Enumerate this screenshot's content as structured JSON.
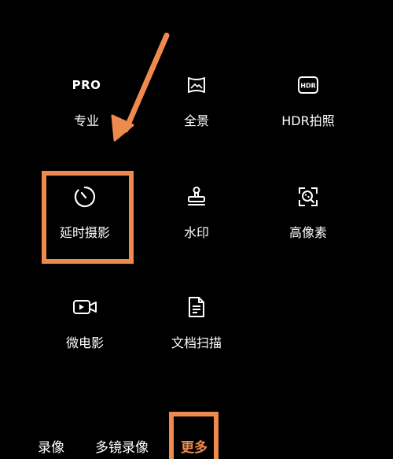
{
  "modes": [
    {
      "id": "pro",
      "icon": "pro-text-icon",
      "icon_text": "PRO",
      "label": "专业"
    },
    {
      "id": "panorama",
      "icon": "panorama-icon",
      "label": "全景"
    },
    {
      "id": "hdr",
      "icon": "hdr-icon",
      "icon_text": "HDR",
      "label": "HDR拍照"
    },
    {
      "id": "timelapse",
      "icon": "timelapse-icon",
      "label": "延时摄影"
    },
    {
      "id": "watermark",
      "icon": "stamp-icon",
      "label": "水印"
    },
    {
      "id": "high-res",
      "icon": "high-res-icon",
      "label": "高像素"
    },
    {
      "id": "micro-movie",
      "icon": "video-camera-icon",
      "label": "微电影"
    },
    {
      "id": "document-scan",
      "icon": "document-icon",
      "label": "文档扫描"
    }
  ],
  "bottom_tabs": [
    {
      "label": "录像"
    },
    {
      "label": "多镜录像"
    },
    {
      "label": "更多",
      "active": true
    }
  ],
  "colors": {
    "accent": "#ef8a4e",
    "background": "#000000",
    "text": "#ffffff"
  }
}
